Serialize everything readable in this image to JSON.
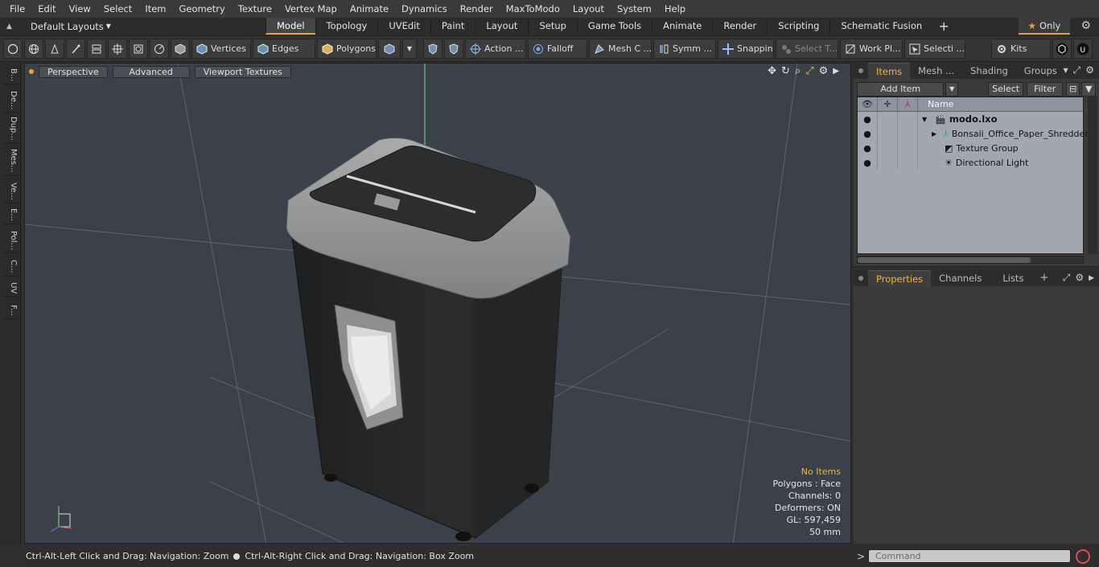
{
  "menu": [
    "File",
    "Edit",
    "View",
    "Select",
    "Item",
    "Geometry",
    "Texture",
    "Vertex Map",
    "Animate",
    "Dynamics",
    "Render",
    "MaxToModo",
    "Layout",
    "System",
    "Help"
  ],
  "layout_selector": "Default Layouts",
  "tabs": [
    {
      "label": "Model",
      "active": true
    },
    {
      "label": "Topology",
      "active": false
    },
    {
      "label": "UVEdit",
      "active": false
    },
    {
      "label": "Paint",
      "active": false
    },
    {
      "label": "Layout",
      "active": false
    },
    {
      "label": "Setup",
      "active": false
    },
    {
      "label": "Game Tools",
      "active": false
    },
    {
      "label": "Animate",
      "active": false
    },
    {
      "label": "Render",
      "active": false
    },
    {
      "label": "Scripting",
      "active": false
    },
    {
      "label": "Schematic Fusion",
      "active": false
    }
  ],
  "only_label": "Only",
  "toolbar": {
    "vertices": "Vertices",
    "edges": "Edges",
    "polygons": "Polygons",
    "action": "Action ...",
    "falloff": "Falloff",
    "mesh": "Mesh C ...",
    "symm": "Symm ...",
    "snapping": "Snapping",
    "select_t": "Select T...",
    "work_plane": "Work Pl...",
    "selecti": "Selecti ...",
    "kits": "Kits"
  },
  "left_tabs": [
    "B...",
    "De...",
    "Dup...",
    "Mes...",
    "Ve...",
    "E...",
    "Pol...",
    "C...",
    "UV",
    "F..."
  ],
  "viewport": {
    "view": "Perspective",
    "shading": "Advanced",
    "textures": "Viewport Textures",
    "info": {
      "selection": "No Items",
      "polygons": "Polygons : Face",
      "channels": "Channels: 0",
      "deformers": "Deformers: ON",
      "gl": "GL: 597,459",
      "units": "50 mm"
    }
  },
  "status": {
    "left": "Ctrl-Alt-Left Click and Drag: Navigation: Zoom",
    "right": "Ctrl-Alt-Right Click and Drag: Navigation: Box Zoom"
  },
  "items_panel": {
    "tabs": [
      "Items",
      "Mesh ...",
      "Shading",
      "Groups"
    ],
    "add_item": "Add Item",
    "select": "Select",
    "filter": "Filter",
    "name_col": "Name",
    "rows": [
      {
        "label": "modo.lxo",
        "icon": "scene-icon"
      },
      {
        "label": "Bonsaii_Office_Paper_Shredder",
        "icon": "mesh-icon"
      },
      {
        "label": "Texture Group",
        "icon": "texture-group-icon"
      },
      {
        "label": "Directional Light",
        "icon": "light-icon"
      }
    ]
  },
  "props_panel": {
    "tabs": [
      "Properties",
      "Channels",
      "Lists"
    ]
  },
  "command": {
    "placeholder": "Command"
  },
  "colors": {
    "accent": "#e8a23c",
    "viewport_bg": "#3a4148",
    "tree_bg": "#a1a8b0"
  }
}
